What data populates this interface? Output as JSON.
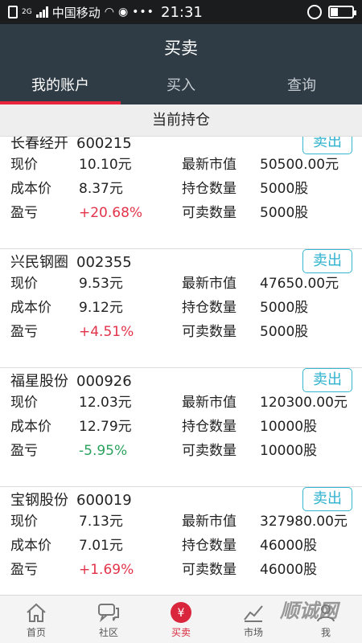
{
  "status_bar": {
    "network": "2G",
    "carrier": "中国移动",
    "time": "21:31",
    "battery_level": 0.35
  },
  "header": {
    "title": "买卖",
    "tabs": [
      {
        "label": "我的账户",
        "active": true
      },
      {
        "label": "买入",
        "active": false
      },
      {
        "label": "查询",
        "active": false
      }
    ]
  },
  "section_title": "当前持仓",
  "labels": {
    "price": "现价",
    "cost": "成本价",
    "pnl": "盈亏",
    "market_value": "最新市值",
    "holding": "持仓数量",
    "sellable": "可卖数量",
    "sell": "卖出"
  },
  "holdings": [
    {
      "name": "长春经开",
      "code": "600215",
      "price": "10.10元",
      "cost": "8.37元",
      "pnl": "+20.68%",
      "pnl_trend": "up",
      "market_value": "50500.00元",
      "holding": "5000股",
      "sellable": "5000股"
    },
    {
      "name": "兴民钢圈",
      "code": "002355",
      "price": "9.53元",
      "cost": "9.12元",
      "pnl": "+4.51%",
      "pnl_trend": "up",
      "market_value": "47650.00元",
      "holding": "5000股",
      "sellable": "5000股"
    },
    {
      "name": "福星股份",
      "code": "000926",
      "price": "12.03元",
      "cost": "12.79元",
      "pnl": "-5.95%",
      "pnl_trend": "down",
      "market_value": "120300.00元",
      "holding": "10000股",
      "sellable": "10000股"
    },
    {
      "name": "宝钢股份",
      "code": "600019",
      "price": "7.13元",
      "cost": "7.01元",
      "pnl": "+1.69%",
      "pnl_trend": "up",
      "market_value": "327980.00元",
      "holding": "46000股",
      "sellable": "46000股"
    }
  ],
  "bottom_nav": [
    {
      "label": "首页",
      "icon": "home-icon",
      "active": false
    },
    {
      "label": "社区",
      "icon": "chat-icon",
      "active": false
    },
    {
      "label": "买卖",
      "icon": "trade-icon",
      "active": true
    },
    {
      "label": "市场",
      "icon": "market-icon",
      "active": false
    },
    {
      "label": "我",
      "icon": "user-icon",
      "active": false
    }
  ],
  "watermark": "顺诚网",
  "colors": {
    "header_bg": "#2f3c45",
    "accent_red": "#e8253f",
    "gain": "#e3334a",
    "loss": "#2aa25e",
    "sell_button": "#2eb2cf"
  }
}
